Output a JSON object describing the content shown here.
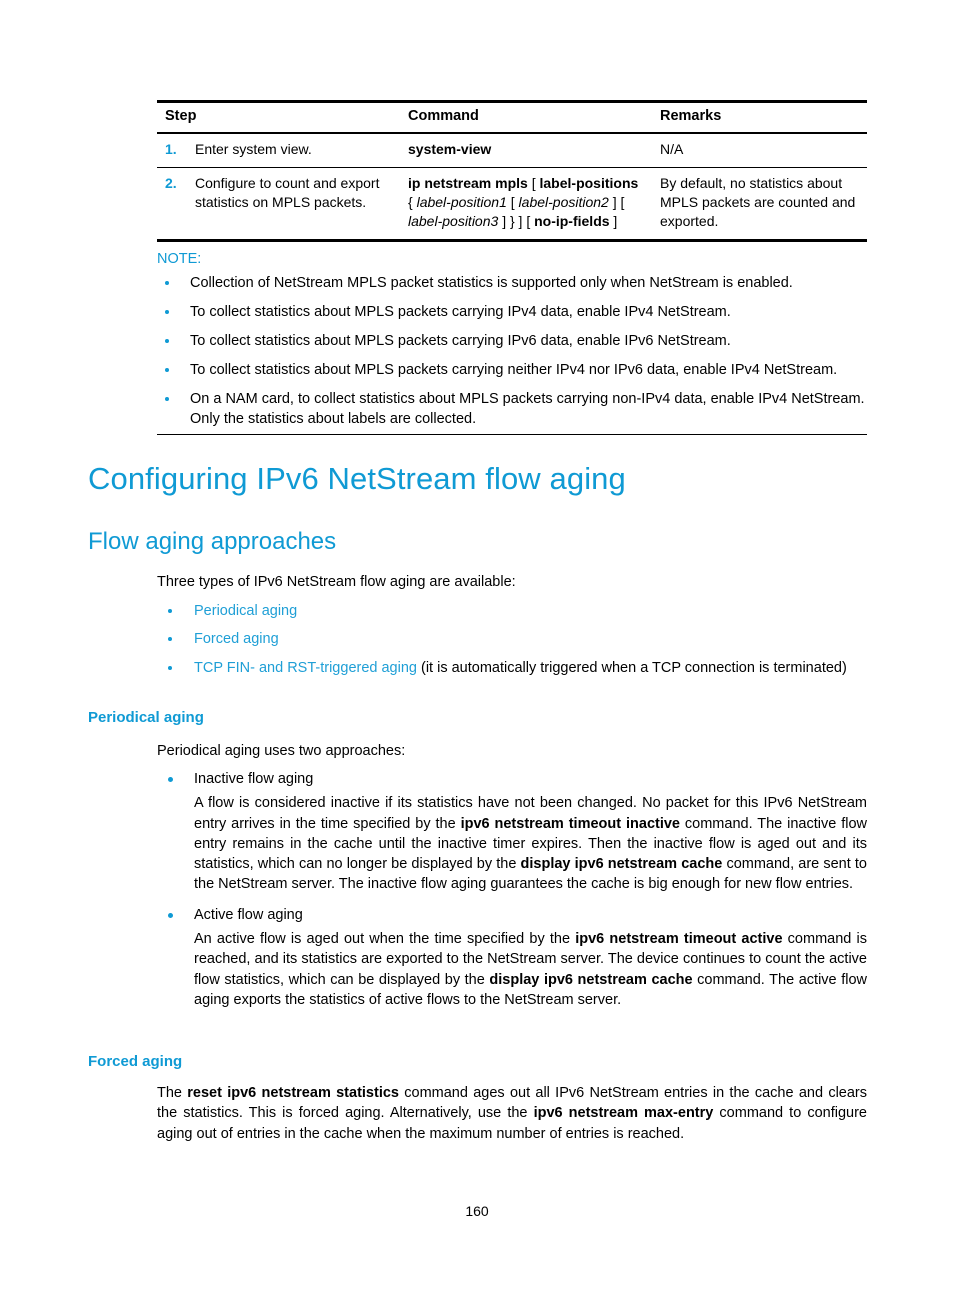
{
  "table": {
    "headers": [
      "Step",
      "Command",
      "Remarks"
    ],
    "rows": [
      {
        "num": "1.",
        "step": "Enter system view.",
        "command_html": "<span class=\"cmd\">system-view</span>",
        "remarks": "N/A"
      },
      {
        "num": "2.",
        "step": "Configure to count and export statistics on MPLS packets.",
        "command_html": "<span class=\"cmd\">ip netstream mpls</span> <span class=\"cmd-lit\">[</span> <span class=\"cmd\">label-positions</span> <span class=\"cmd-lit\">{</span> <span class=\"cmd-var\">label-position1</span> <span class=\"cmd-lit\">[</span> <span class=\"cmd-var\">label-position2</span> <span class=\"cmd-lit\">]</span> <span class=\"cmd-lit\">[</span> <span class=\"cmd-var\">label-position3</span> <span class=\"cmd-lit\">] } ]</span> <span class=\"cmd-lit\">[</span> <span class=\"cmd\">no-ip-fields</span> <span class=\"cmd-lit\">]</span>",
        "remarks": "By default, no statistics about MPLS packets are counted and exported."
      }
    ]
  },
  "note": {
    "label": "NOTE:",
    "items": [
      "Collection of NetStream MPLS packet statistics is supported only when NetStream is enabled.",
      "To collect statistics about MPLS packets carrying IPv4 data, enable IPv4 NetStream.",
      "To collect statistics about MPLS packets carrying IPv6 data, enable IPv6 NetStream.",
      "To collect statistics about MPLS packets carrying neither IPv4 nor IPv6 data, enable IPv4 NetStream.",
      "On a NAM card, to collect statistics about MPLS packets carrying non-IPv4 data, enable IPv4 NetStream. Only the statistics about labels are collected."
    ]
  },
  "headings": {
    "h1": "Configuring IPv6 NetStream flow aging",
    "h2": "Flow aging approaches",
    "h3_periodical": "Periodical aging",
    "h3_forced": "Forced aging"
  },
  "flow_aging": {
    "intro": "Three types of IPv6 NetStream flow aging are available:",
    "links": [
      {
        "link": "Periodical aging",
        "trailing": ""
      },
      {
        "link": "Forced aging",
        "trailing": ""
      },
      {
        "link": "TCP FIN- and RST-triggered aging",
        "trailing": " (it is automatically triggered when a TCP connection is terminated)"
      }
    ]
  },
  "periodical": {
    "intro": "Periodical aging uses two approaches:",
    "items": [
      {
        "title": "Inactive flow aging",
        "body_html": "A flow is considered inactive if its statistics have not been changed. No packet for this IPv6 NetStream entry arrives in the time specified by the <b>ipv6 netstream timeout inactive</b> command. The inactive flow entry remains in the cache until the inactive timer expires. Then the inactive flow is aged out and its statistics, which can no longer be displayed by the <b>display ipv6 netstream cache</b> command, are sent to the NetStream server. The inactive flow aging guarantees the cache is big enough for new flow entries."
      },
      {
        "title": "Active flow aging",
        "body_html": "An active flow is aged out when the time specified by the <b>ipv6 netstream timeout active</b> command is reached, and its statistics are exported to the NetStream server. The device continues to count the active flow statistics, which can be displayed by the <b>display ipv6 netstream cache</b> command. The active flow aging exports the statistics of active flows to the NetStream server."
      }
    ]
  },
  "forced": {
    "body_html": "The <b>reset ipv6 netstream statistics</b> command ages out all IPv6 NetStream entries in the cache and clears the statistics. This is forced aging. Alternatively, use the <b>ipv6 netstream max-entry</b> command to configure aging out of entries in the cache when the maximum number of entries is reached."
  },
  "footer": {
    "page_number": "160"
  },
  "colors": {
    "accent": "#0f9ad4",
    "link": "#1f9fd6",
    "text": "#000000"
  }
}
